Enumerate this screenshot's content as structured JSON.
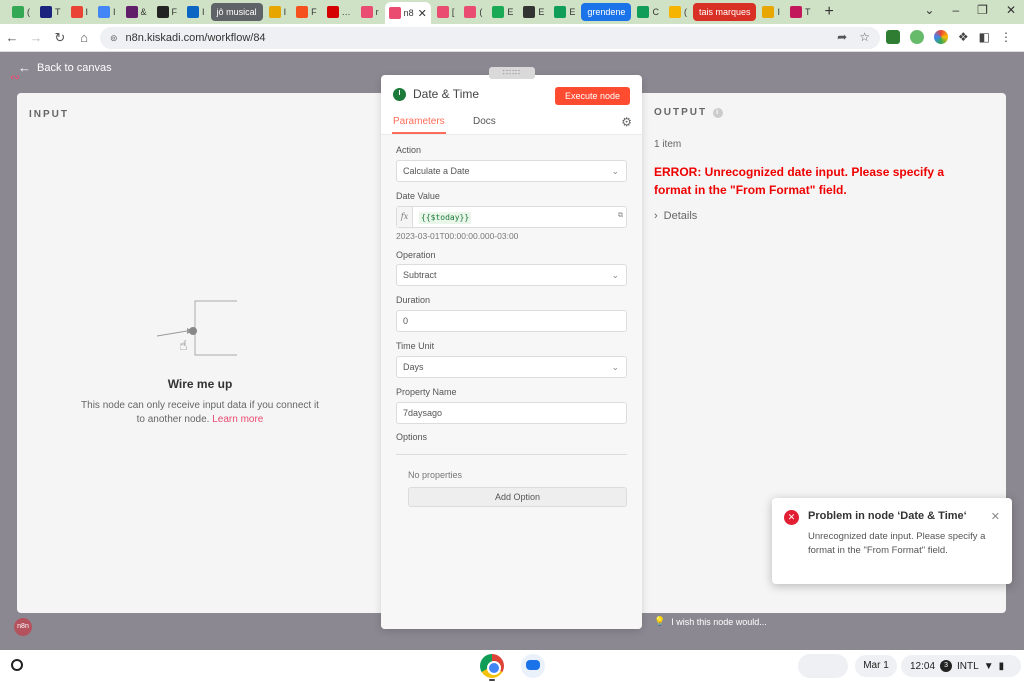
{
  "browser": {
    "tabs": [
      {
        "label": "(",
        "color": "#34a853"
      },
      {
        "label": "T",
        "color": "#1a237e"
      },
      {
        "label": "I",
        "color": "#ea4335"
      },
      {
        "label": "I",
        "color": "#4285f4"
      },
      {
        "label": "&",
        "color": "#611f69"
      },
      {
        "label": "F",
        "color": "#222222"
      },
      {
        "label": "I",
        "color": "#0a66c2"
      },
      {
        "label": "jô musical",
        "color": "#5f6368",
        "pill": true
      },
      {
        "label": "I",
        "color": "#e8a600"
      },
      {
        "label": "F",
        "color": "#f4511e"
      },
      {
        "label": "…",
        "color": "#d50000"
      },
      {
        "label": "r",
        "color": "#ea4b71"
      },
      {
        "label": "n8",
        "color": "#ea4b71",
        "active": true
      },
      {
        "label": "[",
        "color": "#ea4b71"
      },
      {
        "label": "(",
        "color": "#ea4b71"
      },
      {
        "label": "E",
        "color": "#1aaa55"
      },
      {
        "label": "E",
        "color": "#333333"
      },
      {
        "label": "E",
        "color": "#0f9d58"
      },
      {
        "label": "grendene",
        "color": "#1a73e8",
        "pill": true
      },
      {
        "label": "C",
        "color": "#0f9d58"
      },
      {
        "label": "(",
        "color": "#f4b400"
      },
      {
        "label": "tais marques",
        "color": "#d93025",
        "pill": true
      },
      {
        "label": "I",
        "color": "#e8a600"
      },
      {
        "label": "T",
        "color": "#c2185b"
      }
    ],
    "new_tab": "+",
    "url": "n8n.kiskadi.com/workflow/84"
  },
  "app": {
    "back_label": "Back to canvas",
    "input": {
      "title": "INPUT",
      "wire_title": "Wire me up",
      "wire_desc": "This node can only receive input data if you connect it to another node.",
      "learn_more": "Learn more"
    },
    "output": {
      "title": "OUTPUT",
      "item_count": "1 item",
      "error": "ERROR: Unrecognized date input. Please specify a format in the \"From Format\" field.",
      "details": "Details"
    },
    "feedback": "I wish this node would..."
  },
  "node": {
    "title": "Date & Time",
    "execute_label": "Execute node",
    "tabs": [
      "Parameters",
      "Docs"
    ],
    "params": {
      "action_label": "Action",
      "action_value": "Calculate a Date",
      "date_value_label": "Date Value",
      "date_value_expr": "{{$today}}",
      "date_value_preview": "2023-03-01T00:00:00.000-03:00",
      "operation_label": "Operation",
      "operation_value": "Subtract",
      "duration_label": "Duration",
      "duration_value": "0",
      "time_unit_label": "Time Unit",
      "time_unit_value": "Days",
      "property_name_label": "Property Name",
      "property_name_value": "7daysago",
      "options_label": "Options",
      "no_properties": "No properties",
      "add_option": "Add Option"
    }
  },
  "toast": {
    "title": "Problem in node ‘Date & Time‘",
    "body": "Unrecognized date input. Please specify a format in the \"From Format\" field."
  },
  "shelf": {
    "date": "Mar 1",
    "time": "12:04",
    "notification_count": "3",
    "locale": "INTL"
  }
}
